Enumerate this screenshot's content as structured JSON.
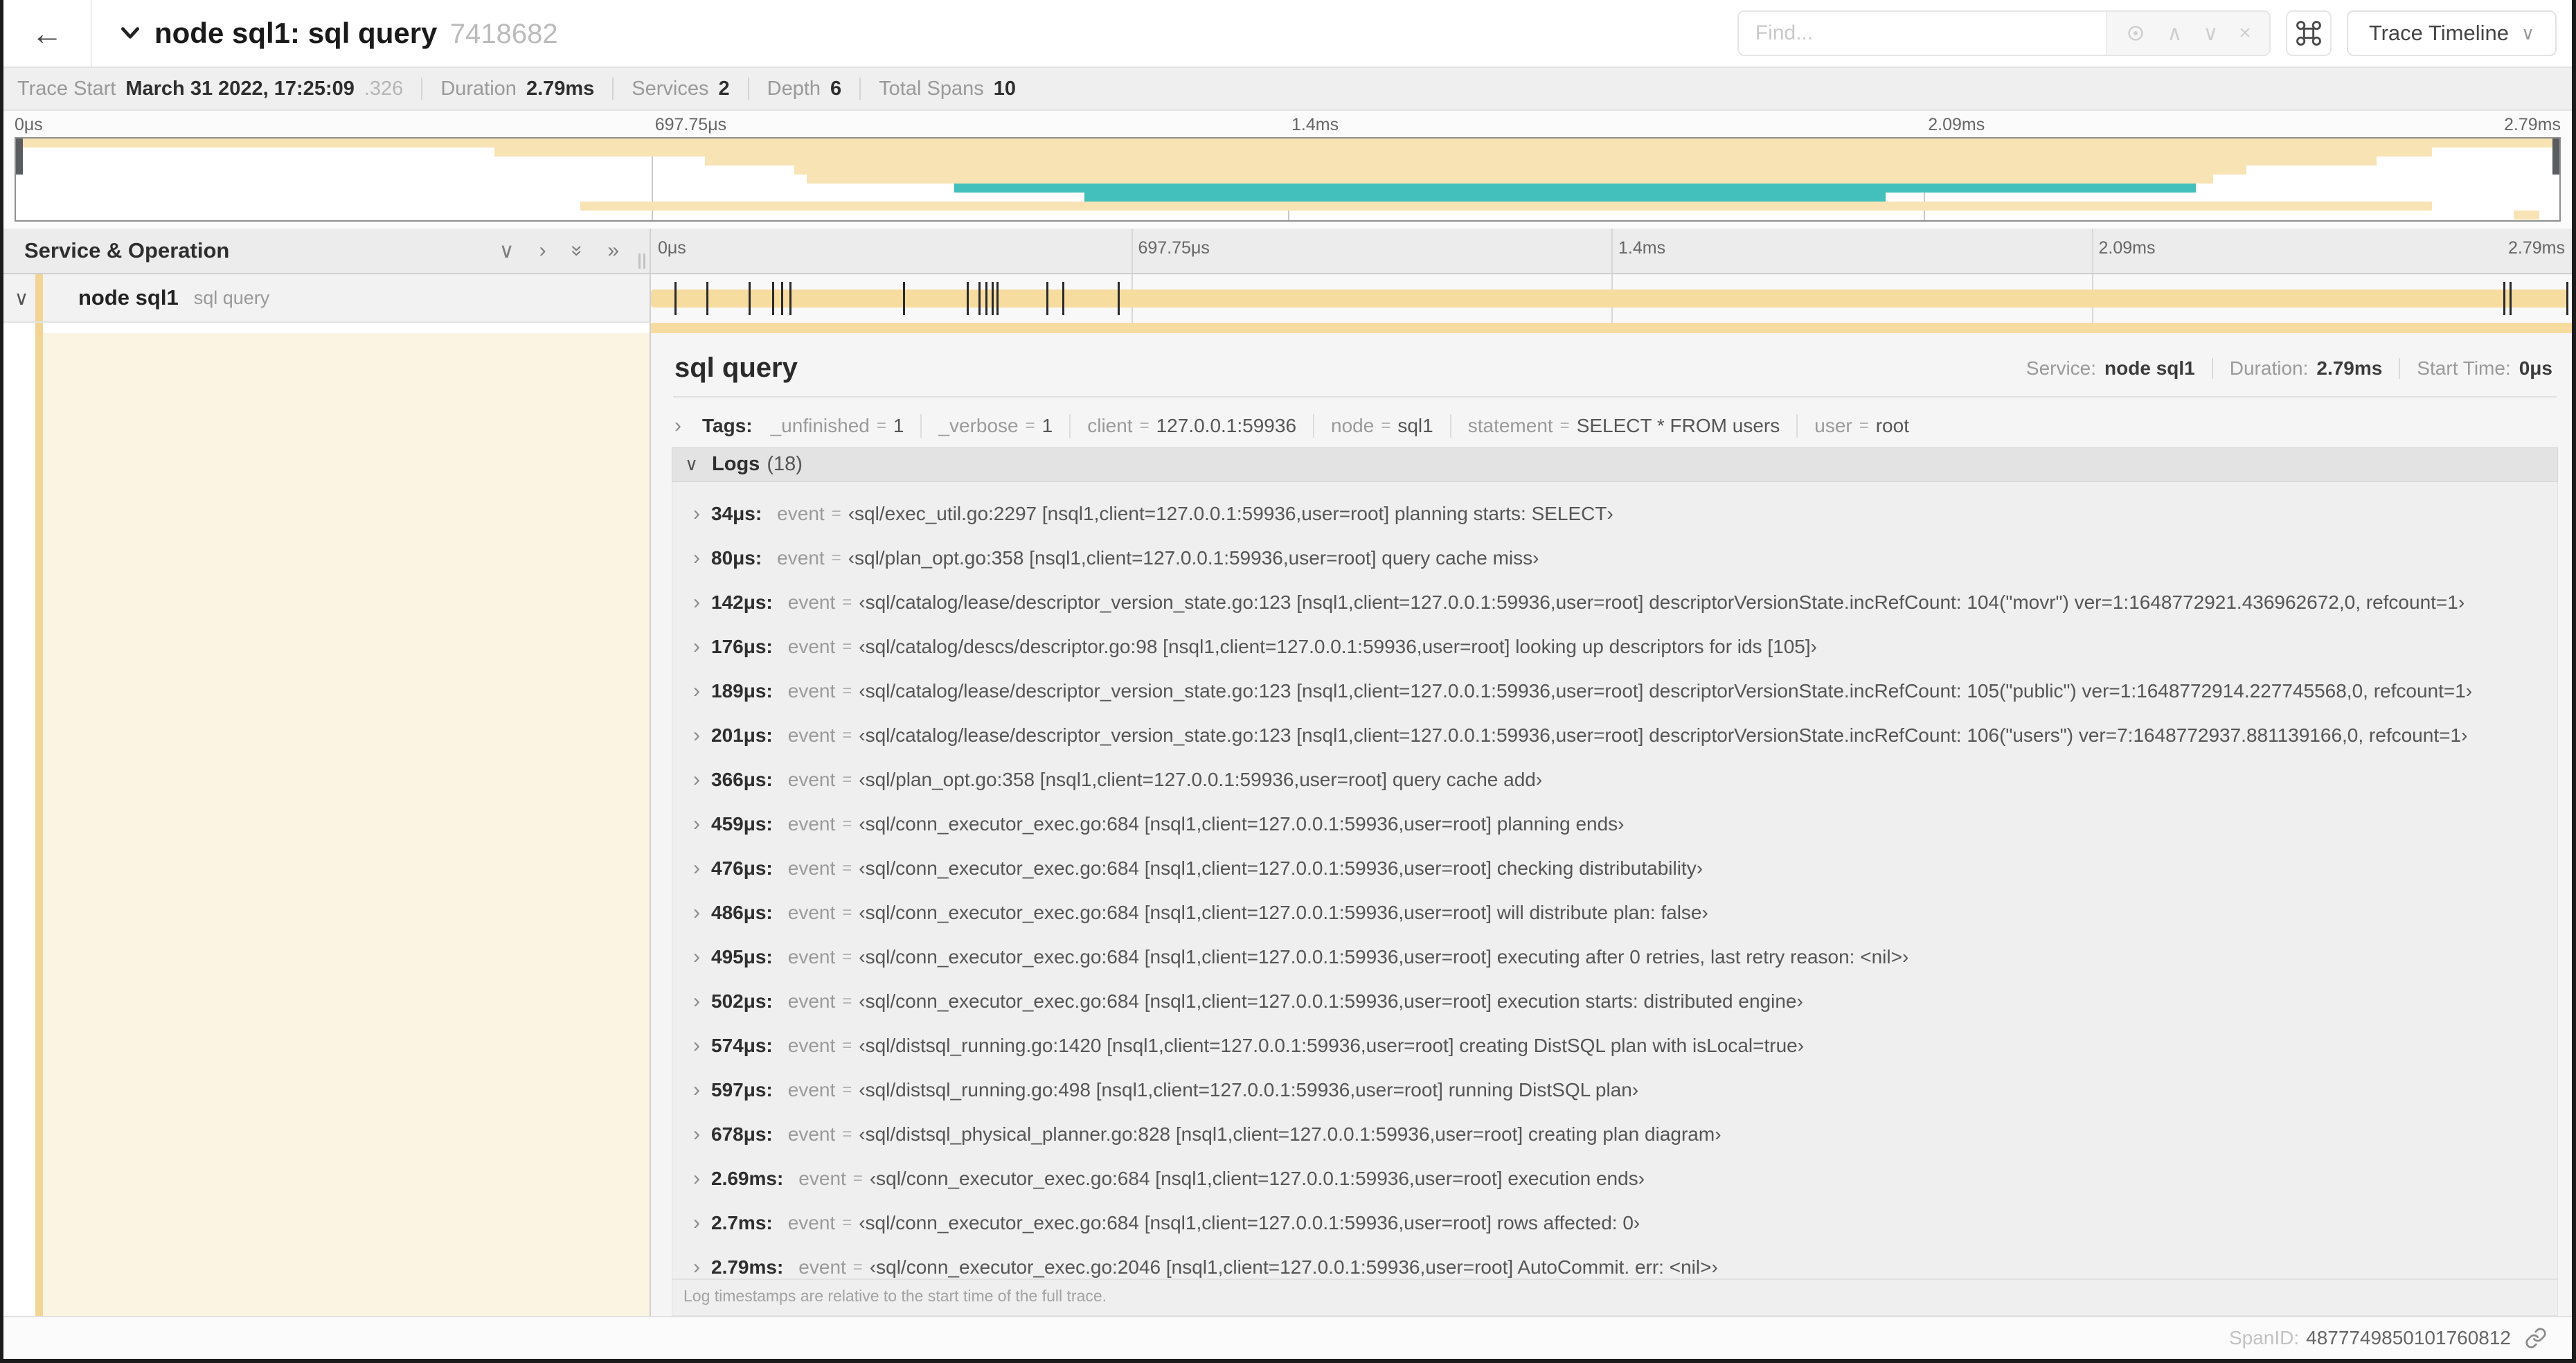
{
  "colors": {
    "tan": "#F7DCA0",
    "tan_minimap": "#F8E3B4",
    "teal": "#44C0BC",
    "stripe": "#F2D595",
    "cream": "#FBF4E3"
  },
  "header": {
    "back_arrow": "←",
    "title": "node sql1: sql query",
    "trace_id": "7418682",
    "find_placeholder": "Find...",
    "view_button": "Trace Timeline"
  },
  "summary": {
    "items": [
      {
        "label": "Trace Start",
        "value": "March 31 2022, 17:25:09",
        "dim": ".326"
      },
      {
        "label": "Duration",
        "value": "2.79ms"
      },
      {
        "label": "Services",
        "value": "2"
      },
      {
        "label": "Depth",
        "value": "6"
      },
      {
        "label": "Total Spans",
        "value": "10"
      }
    ]
  },
  "minimap": {
    "ticks": [
      "0μs",
      "697.75μs",
      "1.4ms",
      "2.09ms",
      "2.79ms"
    ],
    "spans": [
      {
        "row": 0,
        "start": 0.0,
        "end": 1.0,
        "color": "tan"
      },
      {
        "row": 1,
        "start": 0.188,
        "end": 0.95,
        "color": "tan"
      },
      {
        "row": 2,
        "start": 0.271,
        "end": 0.928,
        "color": "tan"
      },
      {
        "row": 3,
        "start": 0.306,
        "end": 0.877,
        "color": "tan"
      },
      {
        "row": 4,
        "start": 0.311,
        "end": 0.864,
        "color": "tan"
      },
      {
        "row": 5,
        "start": 0.369,
        "end": 0.857,
        "color": "teal"
      },
      {
        "row": 6,
        "start": 0.42,
        "end": 0.735,
        "color": "teal"
      },
      {
        "row": 7,
        "start": 0.222,
        "end": 0.95,
        "color": "tan"
      },
      {
        "row": 8,
        "start": 0.982,
        "end": 0.992,
        "color": "tan"
      }
    ]
  },
  "timeline": {
    "header": "Service & Operation",
    "ruler_ticks": [
      "0μs",
      "697.75μs",
      "1.4ms",
      "2.09ms",
      "2.79ms"
    ],
    "row": {
      "service": "node sql1",
      "operation": "sql query",
      "tick_fractions": [
        0.0122,
        0.0287,
        0.0509,
        0.0631,
        0.0677,
        0.0721,
        0.1312,
        0.1645,
        0.1706,
        0.1742,
        0.1774,
        0.1799,
        0.2057,
        0.214,
        0.243,
        0.9642,
        0.9677,
        0.997
      ]
    }
  },
  "detail": {
    "title": "sql query",
    "meta": [
      {
        "label": "Service:",
        "value": "node sql1"
      },
      {
        "label": "Duration:",
        "value": "2.79ms"
      },
      {
        "label": "Start Time:",
        "value": "0μs"
      }
    ],
    "tags": {
      "label": "Tags:",
      "items": [
        {
          "key": "_unfinished",
          "value": "1"
        },
        {
          "key": "_verbose",
          "value": "1"
        },
        {
          "key": "client",
          "value": "127.0.0.1:59936"
        },
        {
          "key": "node",
          "value": "sql1"
        },
        {
          "key": "statement",
          "value": "SELECT * FROM users"
        },
        {
          "key": "user",
          "value": "root"
        }
      ]
    },
    "logs": {
      "label": "Logs",
      "count": "(18)",
      "entries": [
        {
          "time": "34μs:",
          "key": "event",
          "value": "‹sql/exec_util.go:2297 [nsql1,client=127.0.0.1:59936,user=root] planning starts: SELECT›"
        },
        {
          "time": "80μs:",
          "key": "event",
          "value": "‹sql/plan_opt.go:358 [nsql1,client=127.0.0.1:59936,user=root] query cache miss›"
        },
        {
          "time": "142μs:",
          "key": "event",
          "value": "‹sql/catalog/lease/descriptor_version_state.go:123 [nsql1,client=127.0.0.1:59936,user=root] descriptorVersionState.incRefCount: 104(\"movr\") ver=1:1648772921.436962672,0, refcount=1›"
        },
        {
          "time": "176μs:",
          "key": "event",
          "value": "‹sql/catalog/descs/descriptor.go:98 [nsql1,client=127.0.0.1:59936,user=root] looking up descriptors for ids [105]›"
        },
        {
          "time": "189μs:",
          "key": "event",
          "value": "‹sql/catalog/lease/descriptor_version_state.go:123 [nsql1,client=127.0.0.1:59936,user=root] descriptorVersionState.incRefCount: 105(\"public\") ver=1:1648772914.227745568,0, refcount=1›"
        },
        {
          "time": "201μs:",
          "key": "event",
          "value": "‹sql/catalog/lease/descriptor_version_state.go:123 [nsql1,client=127.0.0.1:59936,user=root] descriptorVersionState.incRefCount: 106(\"users\") ver=7:1648772937.881139166,0, refcount=1›"
        },
        {
          "time": "366μs:",
          "key": "event",
          "value": "‹sql/plan_opt.go:358 [nsql1,client=127.0.0.1:59936,user=root] query cache add›"
        },
        {
          "time": "459μs:",
          "key": "event",
          "value": "‹sql/conn_executor_exec.go:684 [nsql1,client=127.0.0.1:59936,user=root] planning ends›"
        },
        {
          "time": "476μs:",
          "key": "event",
          "value": "‹sql/conn_executor_exec.go:684 [nsql1,client=127.0.0.1:59936,user=root] checking distributability›"
        },
        {
          "time": "486μs:",
          "key": "event",
          "value": "‹sql/conn_executor_exec.go:684 [nsql1,client=127.0.0.1:59936,user=root] will distribute plan: false›"
        },
        {
          "time": "495μs:",
          "key": "event",
          "value": "‹sql/conn_executor_exec.go:684 [nsql1,client=127.0.0.1:59936,user=root] executing after 0 retries, last retry reason: <nil>›"
        },
        {
          "time": "502μs:",
          "key": "event",
          "value": "‹sql/conn_executor_exec.go:684 [nsql1,client=127.0.0.1:59936,user=root] execution starts: distributed engine›"
        },
        {
          "time": "574μs:",
          "key": "event",
          "value": "‹sql/distsql_running.go:1420 [nsql1,client=127.0.0.1:59936,user=root] creating DistSQL plan with isLocal=true›"
        },
        {
          "time": "597μs:",
          "key": "event",
          "value": "‹sql/distsql_running.go:498 [nsql1,client=127.0.0.1:59936,user=root] running DistSQL plan›"
        },
        {
          "time": "678μs:",
          "key": "event",
          "value": "‹sql/distsql_physical_planner.go:828 [nsql1,client=127.0.0.1:59936,user=root] creating plan diagram›"
        },
        {
          "time": "2.69ms:",
          "key": "event",
          "value": "‹sql/conn_executor_exec.go:684 [nsql1,client=127.0.0.1:59936,user=root] execution ends›"
        },
        {
          "time": "2.7ms:",
          "key": "event",
          "value": "‹sql/conn_executor_exec.go:684 [nsql1,client=127.0.0.1:59936,user=root] rows affected: 0›"
        },
        {
          "time": "2.79ms:",
          "key": "event",
          "value": "‹sql/conn_executor_exec.go:2046 [nsql1,client=127.0.0.1:59936,user=root] AutoCommit. err: <nil>›"
        }
      ],
      "note": "Log timestamps are relative to the start time of the full trace."
    },
    "footer": {
      "label": "SpanID:",
      "value": "4877749850101760812"
    }
  }
}
